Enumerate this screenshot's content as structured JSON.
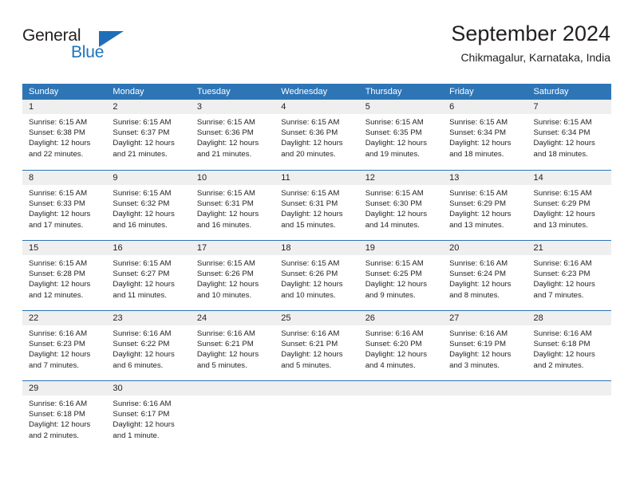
{
  "brand": {
    "name_top": "General",
    "name_bottom": "Blue",
    "mark": "triangle-icon",
    "accent_color": "#1e73be"
  },
  "header": {
    "title": "September 2024",
    "subtitle": "Chikmagalur, Karnataka, India"
  },
  "calendar": {
    "header_bg": "#2e75b6",
    "day_band_bg": "#efefef",
    "weekdays": [
      "Sunday",
      "Monday",
      "Tuesday",
      "Wednesday",
      "Thursday",
      "Friday",
      "Saturday"
    ],
    "weeks": [
      [
        {
          "day": "1",
          "sunrise": "Sunrise: 6:15 AM",
          "sunset": "Sunset: 6:38 PM",
          "daylight1": "Daylight: 12 hours",
          "daylight2": "and 22 minutes."
        },
        {
          "day": "2",
          "sunrise": "Sunrise: 6:15 AM",
          "sunset": "Sunset: 6:37 PM",
          "daylight1": "Daylight: 12 hours",
          "daylight2": "and 21 minutes."
        },
        {
          "day": "3",
          "sunrise": "Sunrise: 6:15 AM",
          "sunset": "Sunset: 6:36 PM",
          "daylight1": "Daylight: 12 hours",
          "daylight2": "and 21 minutes."
        },
        {
          "day": "4",
          "sunrise": "Sunrise: 6:15 AM",
          "sunset": "Sunset: 6:36 PM",
          "daylight1": "Daylight: 12 hours",
          "daylight2": "and 20 minutes."
        },
        {
          "day": "5",
          "sunrise": "Sunrise: 6:15 AM",
          "sunset": "Sunset: 6:35 PM",
          "daylight1": "Daylight: 12 hours",
          "daylight2": "and 19 minutes."
        },
        {
          "day": "6",
          "sunrise": "Sunrise: 6:15 AM",
          "sunset": "Sunset: 6:34 PM",
          "daylight1": "Daylight: 12 hours",
          "daylight2": "and 18 minutes."
        },
        {
          "day": "7",
          "sunrise": "Sunrise: 6:15 AM",
          "sunset": "Sunset: 6:34 PM",
          "daylight1": "Daylight: 12 hours",
          "daylight2": "and 18 minutes."
        }
      ],
      [
        {
          "day": "8",
          "sunrise": "Sunrise: 6:15 AM",
          "sunset": "Sunset: 6:33 PM",
          "daylight1": "Daylight: 12 hours",
          "daylight2": "and 17 minutes."
        },
        {
          "day": "9",
          "sunrise": "Sunrise: 6:15 AM",
          "sunset": "Sunset: 6:32 PM",
          "daylight1": "Daylight: 12 hours",
          "daylight2": "and 16 minutes."
        },
        {
          "day": "10",
          "sunrise": "Sunrise: 6:15 AM",
          "sunset": "Sunset: 6:31 PM",
          "daylight1": "Daylight: 12 hours",
          "daylight2": "and 16 minutes."
        },
        {
          "day": "11",
          "sunrise": "Sunrise: 6:15 AM",
          "sunset": "Sunset: 6:31 PM",
          "daylight1": "Daylight: 12 hours",
          "daylight2": "and 15 minutes."
        },
        {
          "day": "12",
          "sunrise": "Sunrise: 6:15 AM",
          "sunset": "Sunset: 6:30 PM",
          "daylight1": "Daylight: 12 hours",
          "daylight2": "and 14 minutes."
        },
        {
          "day": "13",
          "sunrise": "Sunrise: 6:15 AM",
          "sunset": "Sunset: 6:29 PM",
          "daylight1": "Daylight: 12 hours",
          "daylight2": "and 13 minutes."
        },
        {
          "day": "14",
          "sunrise": "Sunrise: 6:15 AM",
          "sunset": "Sunset: 6:29 PM",
          "daylight1": "Daylight: 12 hours",
          "daylight2": "and 13 minutes."
        }
      ],
      [
        {
          "day": "15",
          "sunrise": "Sunrise: 6:15 AM",
          "sunset": "Sunset: 6:28 PM",
          "daylight1": "Daylight: 12 hours",
          "daylight2": "and 12 minutes."
        },
        {
          "day": "16",
          "sunrise": "Sunrise: 6:15 AM",
          "sunset": "Sunset: 6:27 PM",
          "daylight1": "Daylight: 12 hours",
          "daylight2": "and 11 minutes."
        },
        {
          "day": "17",
          "sunrise": "Sunrise: 6:15 AM",
          "sunset": "Sunset: 6:26 PM",
          "daylight1": "Daylight: 12 hours",
          "daylight2": "and 10 minutes."
        },
        {
          "day": "18",
          "sunrise": "Sunrise: 6:15 AM",
          "sunset": "Sunset: 6:26 PM",
          "daylight1": "Daylight: 12 hours",
          "daylight2": "and 10 minutes."
        },
        {
          "day": "19",
          "sunrise": "Sunrise: 6:15 AM",
          "sunset": "Sunset: 6:25 PM",
          "daylight1": "Daylight: 12 hours",
          "daylight2": "and 9 minutes."
        },
        {
          "day": "20",
          "sunrise": "Sunrise: 6:16 AM",
          "sunset": "Sunset: 6:24 PM",
          "daylight1": "Daylight: 12 hours",
          "daylight2": "and 8 minutes."
        },
        {
          "day": "21",
          "sunrise": "Sunrise: 6:16 AM",
          "sunset": "Sunset: 6:23 PM",
          "daylight1": "Daylight: 12 hours",
          "daylight2": "and 7 minutes."
        }
      ],
      [
        {
          "day": "22",
          "sunrise": "Sunrise: 6:16 AM",
          "sunset": "Sunset: 6:23 PM",
          "daylight1": "Daylight: 12 hours",
          "daylight2": "and 7 minutes."
        },
        {
          "day": "23",
          "sunrise": "Sunrise: 6:16 AM",
          "sunset": "Sunset: 6:22 PM",
          "daylight1": "Daylight: 12 hours",
          "daylight2": "and 6 minutes."
        },
        {
          "day": "24",
          "sunrise": "Sunrise: 6:16 AM",
          "sunset": "Sunset: 6:21 PM",
          "daylight1": "Daylight: 12 hours",
          "daylight2": "and 5 minutes."
        },
        {
          "day": "25",
          "sunrise": "Sunrise: 6:16 AM",
          "sunset": "Sunset: 6:21 PM",
          "daylight1": "Daylight: 12 hours",
          "daylight2": "and 5 minutes."
        },
        {
          "day": "26",
          "sunrise": "Sunrise: 6:16 AM",
          "sunset": "Sunset: 6:20 PM",
          "daylight1": "Daylight: 12 hours",
          "daylight2": "and 4 minutes."
        },
        {
          "day": "27",
          "sunrise": "Sunrise: 6:16 AM",
          "sunset": "Sunset: 6:19 PM",
          "daylight1": "Daylight: 12 hours",
          "daylight2": "and 3 minutes."
        },
        {
          "day": "28",
          "sunrise": "Sunrise: 6:16 AM",
          "sunset": "Sunset: 6:18 PM",
          "daylight1": "Daylight: 12 hours",
          "daylight2": "and 2 minutes."
        }
      ],
      [
        {
          "day": "29",
          "sunrise": "Sunrise: 6:16 AM",
          "sunset": "Sunset: 6:18 PM",
          "daylight1": "Daylight: 12 hours",
          "daylight2": "and 2 minutes."
        },
        {
          "day": "30",
          "sunrise": "Sunrise: 6:16 AM",
          "sunset": "Sunset: 6:17 PM",
          "daylight1": "Daylight: 12 hours",
          "daylight2": "and 1 minute."
        },
        {
          "day": "",
          "sunrise": "",
          "sunset": "",
          "daylight1": "",
          "daylight2": ""
        },
        {
          "day": "",
          "sunrise": "",
          "sunset": "",
          "daylight1": "",
          "daylight2": ""
        },
        {
          "day": "",
          "sunrise": "",
          "sunset": "",
          "daylight1": "",
          "daylight2": ""
        },
        {
          "day": "",
          "sunrise": "",
          "sunset": "",
          "daylight1": "",
          "daylight2": ""
        },
        {
          "day": "",
          "sunrise": "",
          "sunset": "",
          "daylight1": "",
          "daylight2": ""
        }
      ]
    ]
  }
}
